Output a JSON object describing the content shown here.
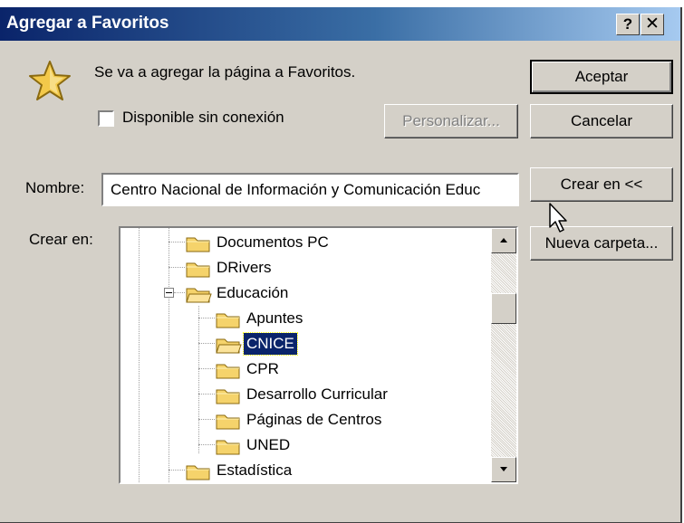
{
  "window": {
    "title": "Agregar a Favoritos",
    "help_label": "?",
    "close_label": "✕"
  },
  "message": "Se va a agregar la página a Favoritos.",
  "offline_checkbox": {
    "label": "Disponible sin conexión",
    "checked": false
  },
  "buttons": {
    "accept": "Aceptar",
    "cancel": "Cancelar",
    "customize": "Personalizar...",
    "create_in": "Crear en <<",
    "new_folder": "Nueva carpeta..."
  },
  "name_field": {
    "label": "Nombre:",
    "value": "Centro Nacional de Información y Comunicación Educ"
  },
  "create_in_label": "Crear en:",
  "tree": {
    "items": [
      {
        "label": "Documentos PC",
        "selected": false
      },
      {
        "label": "DRivers",
        "selected": false
      },
      {
        "label": "Educación",
        "selected": false,
        "expanded": true
      },
      {
        "label": "Apuntes",
        "selected": false
      },
      {
        "label": "CNICE",
        "selected": true
      },
      {
        "label": "CPR",
        "selected": false
      },
      {
        "label": "Desarrollo Curricular",
        "selected": false
      },
      {
        "label": "Páginas de Centros",
        "selected": false
      },
      {
        "label": "UNED",
        "selected": false
      },
      {
        "label": "Estadística",
        "selected": false
      }
    ],
    "scroll_position": 0.3
  },
  "colors": {
    "title_bar_start": "#0a246a",
    "title_bar_end": "#a6caf0",
    "selection": "#0a246a",
    "dialog_face": "#d4d0c8"
  }
}
